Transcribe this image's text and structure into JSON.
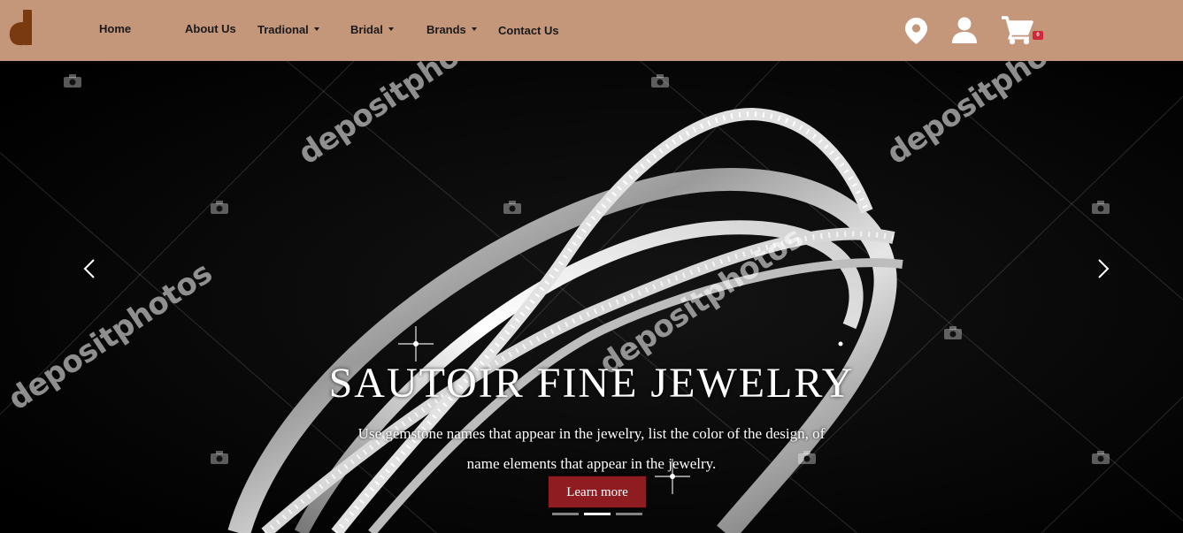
{
  "nav": {
    "items": [
      {
        "label": "Home"
      },
      {
        "label": "About Us"
      },
      {
        "label": "Tradional"
      },
      {
        "label": "Bridal"
      },
      {
        "label": "Brands"
      },
      {
        "label": "Contact Us"
      }
    ],
    "cart_count": "0",
    "brand_color": "#c4967a",
    "logo_color": "#7a3a10"
  },
  "hero": {
    "title": "SAUTOIR FINE JEWELRY",
    "description_line1": "Use gemstone names that appear in the jewelry, list the color of the design, of",
    "description_line2": "name elements that appear in the jewelry.",
    "button_label": "Learn more",
    "button_color": "#8f1c20",
    "watermark_text": "depositphotos",
    "slide_count": 3,
    "active_slide": 2
  }
}
